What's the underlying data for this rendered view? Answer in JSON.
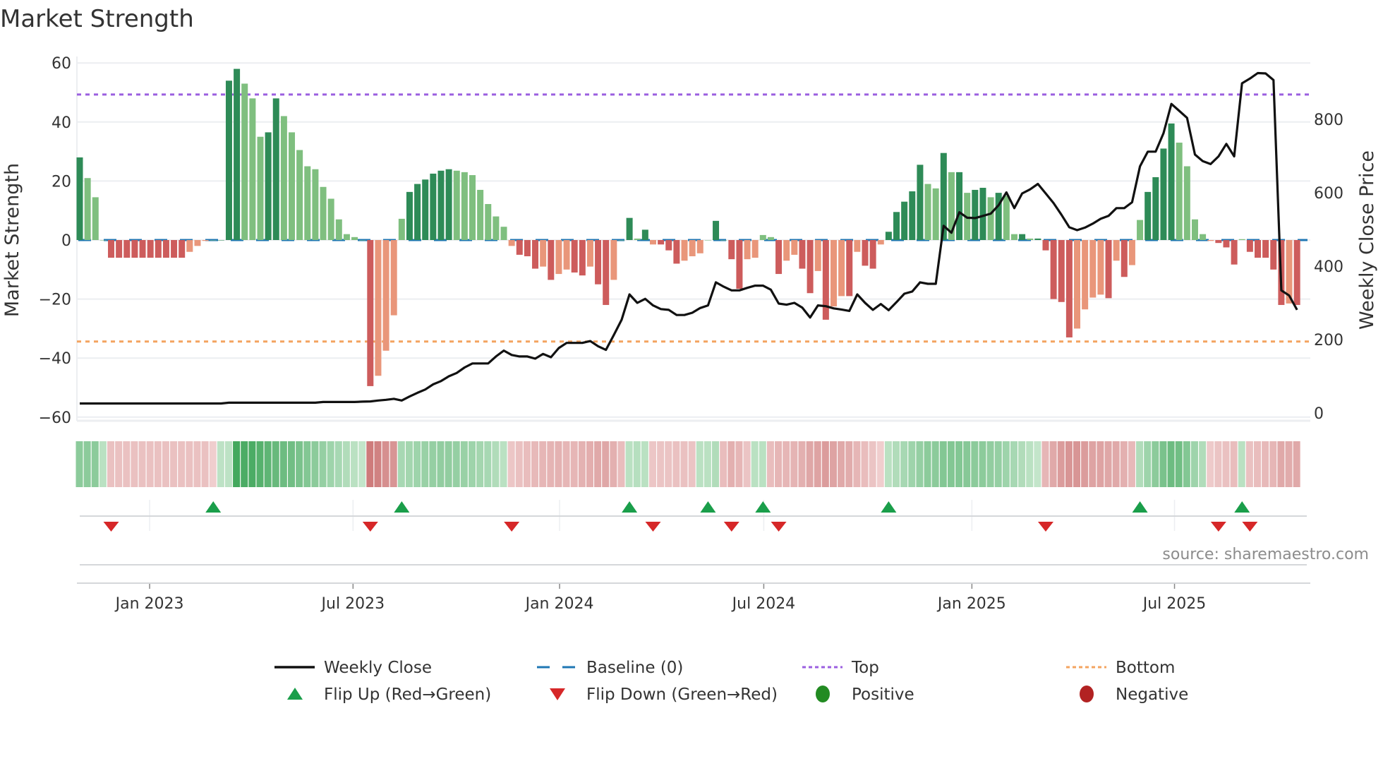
{
  "title": "Market Strength",
  "source": "source: sharemaestro.com",
  "colors": {
    "pos_strong": "#2e8b57",
    "pos_weak": "#7fbf7f",
    "neg_strong": "#cd5c5c",
    "neg_weak": "#e9967a",
    "line": "#111111",
    "baseline": "#1f77b4",
    "top": "#9b5fe0",
    "bottom": "#f4a460",
    "flip_up": "#1a9e4a",
    "flip_down": "#d62728",
    "positive": "#228b22",
    "negative": "#b22222"
  },
  "chart_data": {
    "type": "bar+line",
    "title": "Market Strength",
    "ylabel": "Market Strength",
    "y2label": "Weekly Close Price",
    "ylim": [
      -60,
      60
    ],
    "y2lim": [
      0,
      900
    ],
    "yticks": [
      "60",
      "40",
      "20",
      "0",
      "−20",
      "−40",
      "−60"
    ],
    "ytick_values": [
      60,
      40,
      20,
      0,
      -20,
      -40,
      -60
    ],
    "y2ticks": [
      "800",
      "600",
      "400",
      "200",
      "0"
    ],
    "y2tick_values": [
      800,
      600,
      400,
      200,
      0
    ],
    "xticks": [
      {
        "label": "Jan 2023",
        "week": 8.9
      },
      {
        "label": "Jul 2023",
        "week": 34.8
      },
      {
        "label": "Jan 2024",
        "week": 61.1
      },
      {
        "label": "Jul 2024",
        "week": 87.1
      },
      {
        "label": "Jan 2025",
        "week": 113.6
      },
      {
        "label": "Jul 2025",
        "week": 139.4
      }
    ],
    "top_level": 49.3,
    "bottom_level": -34.4,
    "baseline": 0,
    "strength": [
      28,
      21,
      14.5,
      0,
      -6,
      -6,
      -6,
      -6,
      -6,
      -6,
      -6,
      -6,
      -6,
      -6,
      -4,
      -2,
      -0.3,
      0,
      0,
      54,
      58,
      53,
      48,
      35,
      36.5,
      48,
      42,
      36.5,
      30.5,
      25,
      24,
      18,
      14,
      7,
      2,
      1,
      0,
      -49.5,
      -46,
      -37.5,
      -25.5,
      7.2,
      16.3,
      19,
      20.5,
      22.5,
      23.5,
      24,
      23.5,
      23,
      22,
      17,
      12.2,
      8,
      4.5,
      -2,
      -5,
      -5.5,
      -9.7,
      -9,
      -13.5,
      -11.5,
      -10,
      -11,
      -12,
      -9,
      -15,
      -22,
      -13.5,
      0,
      7.5,
      0.5,
      3.5,
      -1.5,
      -1.5,
      -3.5,
      -8,
      -7,
      -5.5,
      -4.5,
      0,
      6.5,
      0,
      -6.5,
      -16.5,
      -6.5,
      -6,
      1.7,
      1,
      -11.5,
      -7,
      -5,
      -9.7,
      -18,
      -10.5,
      -27,
      -22.5,
      -19,
      -19,
      -4,
      -8.7,
      -9.7,
      -1.5,
      2.8,
      9.5,
      13,
      16.5,
      25.5,
      19,
      17.5,
      29.5,
      23,
      23,
      16,
      17,
      17.7,
      14.5,
      16,
      15,
      2,
      2,
      0.5,
      0.5,
      -3.5,
      -20,
      -21,
      -33,
      -30,
      -23.5,
      -19.5,
      -18.5,
      -19.7,
      -7,
      -12.5,
      -8.5,
      6.8,
      16.3,
      21.3,
      31,
      39.5,
      33,
      25,
      7,
      2,
      -0.3,
      -1,
      -2.5,
      -8.3,
      0.3,
      -4,
      -6,
      -6,
      -10,
      -22,
      -21.5,
      -22
    ],
    "weekly_close": [
      26,
      26,
      26,
      26,
      26,
      26,
      26,
      26,
      26,
      26,
      26,
      26,
      26,
      26,
      26,
      26,
      26,
      26,
      26,
      28,
      28,
      28,
      28,
      28,
      28,
      28,
      28,
      28,
      28,
      28,
      28,
      30,
      30,
      30,
      30,
      30,
      31,
      31.5,
      34,
      36,
      38.6,
      34,
      45,
      55,
      64,
      78,
      87,
      100,
      109,
      124,
      135,
      135,
      135,
      154,
      170,
      158,
      154,
      154,
      148,
      161,
      152,
      177,
      191,
      191,
      191,
      196,
      182,
      172,
      212,
      254,
      323,
      300,
      311,
      293,
      283,
      281,
      267,
      267,
      273,
      286,
      293,
      356,
      344,
      334,
      334,
      341,
      347,
      347,
      336,
      298,
      295,
      300,
      287,
      260,
      293,
      291,
      285,
      282,
      278,
      323,
      300,
      281,
      297,
      280,
      302,
      325,
      331,
      356,
      352,
      352,
      510,
      491,
      547,
      532,
      531,
      537,
      543,
      566,
      601,
      558,
      598,
      609,
      624,
      598,
      572,
      540,
      506,
      498,
      505,
      516,
      529,
      537,
      558,
      558,
      574,
      672,
      712,
      712,
      762,
      842,
      823,
      804,
      704,
      686,
      678,
      699,
      733,
      699,
      898,
      911,
      926,
      925,
      907,
      334,
      320,
      281
    ],
    "heat": [
      0.45,
      0.45,
      0.45,
      0.2,
      -0.22,
      -0.22,
      -0.22,
      -0.22,
      -0.22,
      -0.22,
      -0.22,
      -0.22,
      -0.22,
      -0.22,
      -0.22,
      -0.22,
      -0.22,
      -0.12,
      0.18,
      0.18,
      0.85,
      0.8,
      0.8,
      0.75,
      0.7,
      0.65,
      0.62,
      0.6,
      0.55,
      0.5,
      0.45,
      0.4,
      0.35,
      0.3,
      0.25,
      0.2,
      0.15,
      -0.75,
      -0.7,
      -0.6,
      -0.55,
      0.3,
      0.32,
      0.35,
      0.38,
      0.4,
      0.42,
      0.42,
      0.4,
      0.38,
      0.35,
      0.32,
      0.3,
      0.25,
      0.2,
      -0.18,
      -0.22,
      -0.25,
      -0.28,
      -0.3,
      -0.32,
      -0.33,
      -0.3,
      -0.3,
      -0.33,
      -0.36,
      -0.4,
      -0.42,
      -0.35,
      -0.25,
      0.2,
      0.22,
      0.2,
      -0.18,
      -0.2,
      -0.2,
      -0.22,
      -0.22,
      -0.2,
      0.2,
      0.2,
      0.25,
      -0.25,
      -0.35,
      -0.3,
      -0.2,
      0.2,
      0.2,
      -0.25,
      -0.3,
      -0.3,
      -0.32,
      -0.35,
      -0.42,
      -0.45,
      -0.5,
      -0.45,
      -0.4,
      -0.38,
      -0.3,
      -0.25,
      -0.2,
      -0.12,
      0.2,
      0.25,
      0.3,
      0.35,
      0.4,
      0.45,
      0.45,
      0.5,
      0.5,
      0.5,
      0.48,
      0.45,
      0.45,
      0.42,
      0.4,
      0.35,
      0.3,
      0.25,
      0.2,
      0.15,
      -0.3,
      -0.4,
      -0.5,
      -0.55,
      -0.55,
      -0.5,
      -0.45,
      -0.45,
      -0.42,
      -0.4,
      -0.35,
      -0.28,
      0.25,
      0.35,
      0.45,
      0.55,
      0.62,
      0.6,
      0.5,
      0.35,
      0.25,
      -0.15,
      -0.2,
      -0.22,
      -0.25,
      0.2,
      -0.22,
      -0.25,
      -0.28,
      -0.3,
      -0.4,
      -0.38,
      -0.4
    ],
    "flip_up_weeks": [
      17,
      41,
      70,
      80,
      87,
      103,
      135,
      148
    ],
    "flip_down_weeks": [
      4,
      37,
      55,
      73,
      83,
      89,
      123,
      145,
      149
    ]
  },
  "legend": [
    {
      "label": "Weekly Close",
      "icon": "solid-line"
    },
    {
      "label": "Baseline (0)",
      "icon": "dashed-line"
    },
    {
      "label": "Top",
      "icon": "dotted-line-purple"
    },
    {
      "label": "Bottom",
      "icon": "dotted-line-orange"
    },
    {
      "label": "Flip Up (Red→Green)",
      "icon": "triangle-up"
    },
    {
      "label": "Flip Down (Green→Red)",
      "icon": "triangle-down"
    },
    {
      "label": "Positive",
      "icon": "circle-green"
    },
    {
      "label": "Negative",
      "icon": "circle-red"
    }
  ]
}
